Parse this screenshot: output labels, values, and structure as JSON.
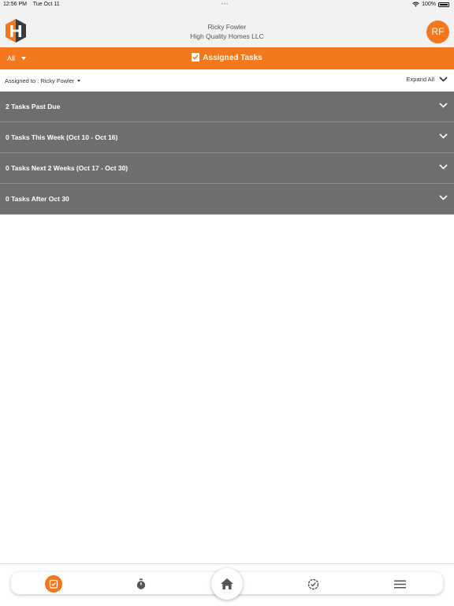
{
  "status_bar": {
    "time": "12:56 PM",
    "date": "Tue Oct 11",
    "multitask_dots": "•••",
    "battery_percent": "100%",
    "icons": [
      "wifi-icon",
      "battery-icon"
    ]
  },
  "header": {
    "user_name": "Ricky Fowler",
    "company_name": "High Quality Homes LLC",
    "avatar_initials": "RF",
    "logo_icon": "company-logo"
  },
  "title_bar": {
    "filter_label": "All",
    "title": "Assigned Tasks",
    "title_icon": "checkbox-icon"
  },
  "assigned_row": {
    "assigned_label": "Assigned to : Ricky Fowler",
    "expand_all_label": "Expand All"
  },
  "task_groups": [
    {
      "label": "2 Tasks Past Due"
    },
    {
      "label": "0 Tasks This Week (Oct 10 - Oct 16)"
    },
    {
      "label": "0 Tasks Next 2 Weeks (Oct 17 - Oct 30)"
    },
    {
      "label": "0 Tasks After Oct 30"
    }
  ],
  "tab_bar": {
    "tabs": [
      {
        "name": "tasks",
        "icon": "task-check-icon",
        "active": true
      },
      {
        "name": "timer",
        "icon": "stopwatch-icon",
        "active": false
      },
      {
        "name": "home",
        "icon": "home-icon",
        "active": false
      },
      {
        "name": "approvals",
        "icon": "badge-check-icon",
        "active": false
      },
      {
        "name": "menu",
        "icon": "hamburger-menu-icon",
        "active": false
      }
    ]
  },
  "colors": {
    "accent": "#f2771d",
    "group_background": "#6e6e6e",
    "header_background": "#f2f2f2"
  }
}
